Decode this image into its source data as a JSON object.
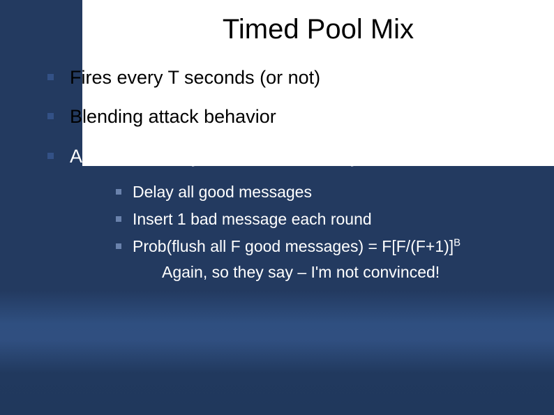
{
  "title": "Timed Pool Mix",
  "bullets": [
    {
      "text": "Fires every T seconds (or not)",
      "tone": "dark"
    },
    {
      "text": "Blending attack behavior",
      "tone": "dark"
    },
    {
      "text": "Attacker can try to flush over many rounds",
      "tone": "light"
    }
  ],
  "sub_bullets": [
    "Delay all good messages",
    "Insert 1 bad message each round"
  ],
  "prob_prefix": "Prob(flush all F good messages) = F[F/(F+1)]",
  "prob_exponent": "B",
  "closing_line": "Again, so they say – I'm not convinced!"
}
